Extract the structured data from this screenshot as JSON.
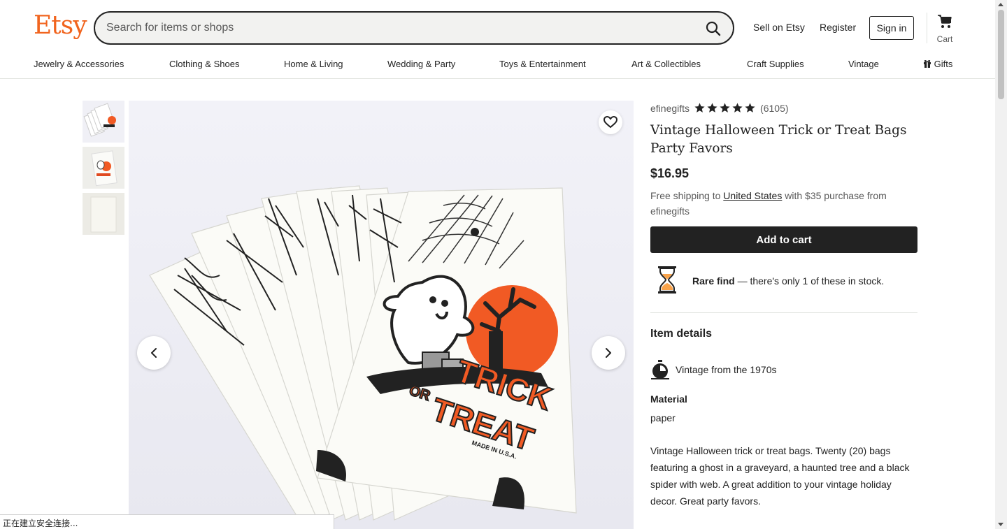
{
  "header": {
    "logo": "Etsy",
    "search_placeholder": "Search for items or shops",
    "sell": "Sell on Etsy",
    "register": "Register",
    "signin": "Sign in",
    "cart": "Cart"
  },
  "categories": [
    "Jewelry & Accessories",
    "Clothing & Shoes",
    "Home & Living",
    "Wedding & Party",
    "Toys & Entertainment",
    "Art & Collectibles",
    "Craft Supplies",
    "Vintage",
    "Gifts"
  ],
  "listing": {
    "shop_name": "efinegifts",
    "rating": 5,
    "review_count": "(6105)",
    "title": "Vintage Halloween Trick or Treat Bags Party Favors",
    "price": "$16.95",
    "shipping_prefix": "Free shipping to ",
    "shipping_country": "United States",
    "shipping_suffix": " with $35 purchase from efinegifts",
    "add_to_cart": "Add to cart",
    "rare_bold": "Rare find",
    "rare_rest": " — there's only 1 of these in stock.",
    "details_heading": "Item details",
    "vintage": "Vintage from the 1970s",
    "material_heading": "Material",
    "material": "paper",
    "description": "Vintage Halloween trick or treat bags. Twenty (20) bags featuring a ghost in a graveyard, a haunted tree and a black spider with web. A great addition to your vintage holiday decor. Great party favors."
  },
  "image_text": {
    "trick": "TRICK",
    "or": "OR",
    "treat": "TREAT",
    "made_in": "MADE IN U.S.A."
  },
  "status_bar": "正在建立安全连接...",
  "colors": {
    "brand": "#f1641e",
    "button": "#222222",
    "moon": "#f15a24"
  }
}
